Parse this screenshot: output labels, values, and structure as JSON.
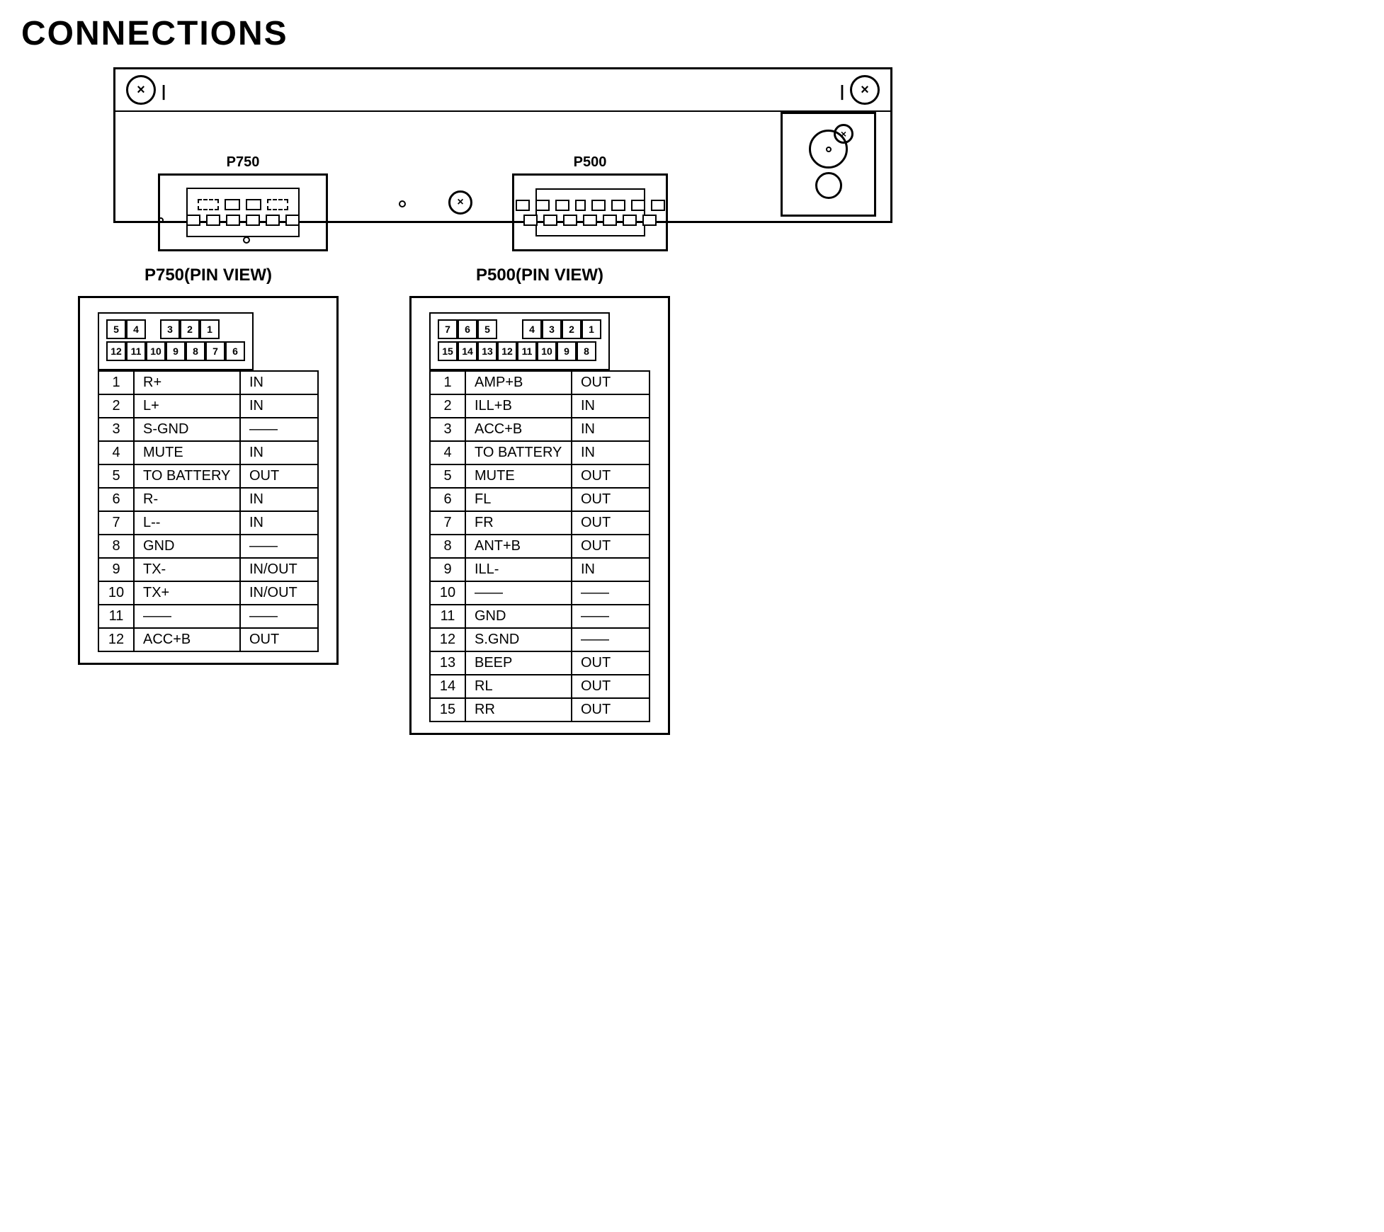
{
  "title": "CONNECTIONS",
  "device": {
    "x_symbol": "×",
    "connector_p750_label": "P750",
    "connector_p500_label": "P500"
  },
  "p750_pin_view": {
    "title": "P750(PIN VIEW)",
    "top_row": [
      "5",
      "4",
      "",
      "3",
      "2",
      "1"
    ],
    "bottom_row": [
      "12",
      "11",
      "10",
      "9",
      "8",
      "7",
      "6"
    ]
  },
  "p500_pin_view": {
    "title": "P500(PIN VIEW)",
    "top_row": [
      "7",
      "6",
      "5",
      "",
      "4",
      "3",
      "2",
      "1"
    ],
    "bottom_row": [
      "15",
      "14",
      "13",
      "12",
      "11",
      "10",
      "9",
      "8"
    ]
  },
  "p750_table": {
    "rows": [
      {
        "pin": "1",
        "signal": "R+",
        "dir": "IN"
      },
      {
        "pin": "2",
        "signal": "L+",
        "dir": "IN"
      },
      {
        "pin": "3",
        "signal": "S-GND",
        "dir": "—"
      },
      {
        "pin": "4",
        "signal": "MUTE",
        "dir": "IN"
      },
      {
        "pin": "5",
        "signal": "TO BATTERY",
        "dir": "OUT"
      },
      {
        "pin": "6",
        "signal": "R-",
        "dir": "IN"
      },
      {
        "pin": "7",
        "signal": "L--",
        "dir": "IN"
      },
      {
        "pin": "8",
        "signal": "GND",
        "dir": "—"
      },
      {
        "pin": "9",
        "signal": "TX-",
        "dir": "IN/OUT"
      },
      {
        "pin": "10",
        "signal": "TX+",
        "dir": "IN/OUT"
      },
      {
        "pin": "11",
        "signal": "—",
        "dir": "—"
      },
      {
        "pin": "12",
        "signal": "ACC+B",
        "dir": "OUT"
      }
    ]
  },
  "p500_table": {
    "rows": [
      {
        "pin": "1",
        "signal": "AMP+B",
        "dir": "OUT"
      },
      {
        "pin": "2",
        "signal": "ILL+B",
        "dir": "IN"
      },
      {
        "pin": "3",
        "signal": "ACC+B",
        "dir": "IN"
      },
      {
        "pin": "4",
        "signal": "TO BATTERY",
        "dir": "IN"
      },
      {
        "pin": "5",
        "signal": "MUTE",
        "dir": "OUT"
      },
      {
        "pin": "6",
        "signal": "FL",
        "dir": "OUT"
      },
      {
        "pin": "7",
        "signal": "FR",
        "dir": "OUT"
      },
      {
        "pin": "8",
        "signal": "ANT+B",
        "dir": "OUT"
      },
      {
        "pin": "9",
        "signal": "ILL-",
        "dir": "IN"
      },
      {
        "pin": "10",
        "signal": "—",
        "dir": "—"
      },
      {
        "pin": "11",
        "signal": "GND",
        "dir": "—"
      },
      {
        "pin": "12",
        "signal": "S.GND",
        "dir": "—"
      },
      {
        "pin": "13",
        "signal": "BEEP",
        "dir": "OUT"
      },
      {
        "pin": "14",
        "signal": "RL",
        "dir": "OUT"
      },
      {
        "pin": "15",
        "signal": "RR",
        "dir": "OUT"
      }
    ]
  }
}
